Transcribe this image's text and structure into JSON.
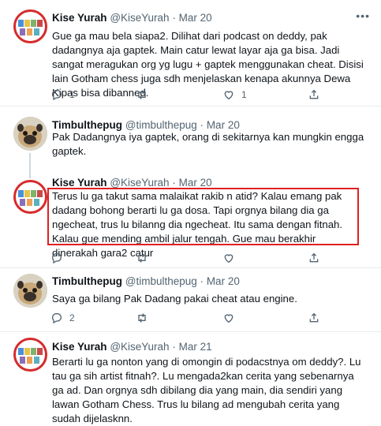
{
  "tweets": [
    {
      "name": "Kise Yurah",
      "handle": "@KiseYurah",
      "date": "Mar 20",
      "avatar": "kise",
      "text": "Gue ga mau bela siapa2. Dilihat dari podcast on deddy, pak dadangnya aja gaptek. Main catur lewat layar aja ga bisa. Jadi sangat meragukan org yg lugu + gaptek menggunakan cheat. Disisi lain Gotham chess juga sdh menjelaskan kenapa akunnya Dewa Kipas bisa dibanned.",
      "replies": "1",
      "retweets": "",
      "likes": "1"
    },
    {
      "name": "Timbulthepug",
      "handle": "@timbulthepug",
      "date": "Mar 20",
      "avatar": "pug",
      "text": "Pak Dadangnya iya gaptek, orang di sekitarnya kan mungkin engga gaptek.",
      "replies": "",
      "retweets": "",
      "likes": ""
    },
    {
      "name": "Kise Yurah",
      "handle": "@KiseYurah",
      "date": "Mar 20",
      "avatar": "kise",
      "text": "Terus lu ga takut sama malaikat rakib n atid? Kalau emang pak dadang bohong berarti lu ga dosa. Tapi orgnya bilang dia ga ngecheat, trus lu bilanng dia ngecheat. Itu sama dengan fitnah. Kalau gue mending ambil jalur tengah. Gue mau berakhir dinerakah gara2 catur",
      "replies": "",
      "retweets": "",
      "likes": ""
    },
    {
      "name": "Timbulthepug",
      "handle": "@timbulthepug",
      "date": "Mar 20",
      "avatar": "pug",
      "text": "Saya ga bilang Pak Dadang pakai cheat atau engine.",
      "replies": "2",
      "retweets": "",
      "likes": ""
    },
    {
      "name": "Kise Yurah",
      "handle": "@KiseYurah",
      "date": "Mar 21",
      "avatar": "kise",
      "text": "Berarti lu ga nonton yang di omongin di podacstnya om deddy?. Lu tau ga sih artist fitnah?. Lu mengada2kan cerita yang sebenarnya ga ad. Dan orgnya sdh dibilang dia yang main, dia sendiri yang lawan Gotham Chess. Trus lu bilang ad mengubah cerita yang sudah dijelasknn."
    }
  ],
  "more_icon": "more-horizontal-icon",
  "highlight_color": "#e02020",
  "accent_color": "#1d9bf0"
}
